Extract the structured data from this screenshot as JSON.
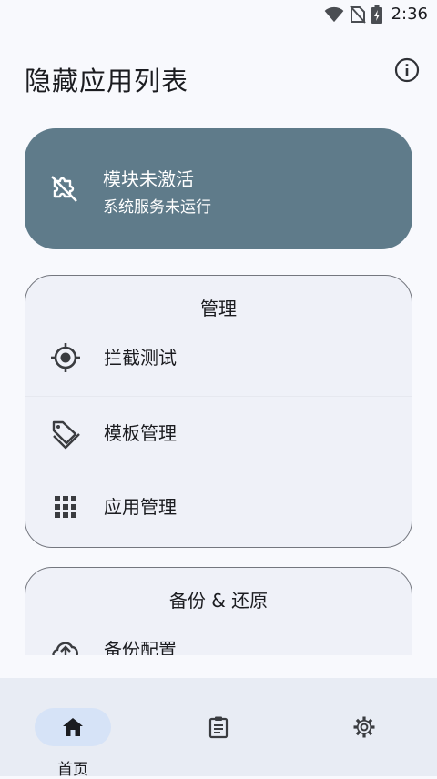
{
  "status_bar": {
    "time": "2:36"
  },
  "app": {
    "title": "隐藏应用列表"
  },
  "module_status": {
    "title": "模块未激活",
    "subtitle": "系统服务未运行"
  },
  "sections": [
    {
      "title": "管理",
      "items": [
        {
          "label": "拦截测试"
        },
        {
          "label": "模板管理"
        },
        {
          "label": "应用管理"
        }
      ]
    },
    {
      "title": "备份 & 还原",
      "items": [
        {
          "label": "备份配置"
        }
      ]
    }
  ],
  "bottom_nav": [
    {
      "label": "首页",
      "active": true
    },
    {
      "label": "",
      "active": false
    },
    {
      "label": "",
      "active": false
    }
  ],
  "colors": {
    "status_card": "#5f7b8a",
    "nav_pill": "#d6e3f7",
    "background": "#f8f9fd"
  }
}
